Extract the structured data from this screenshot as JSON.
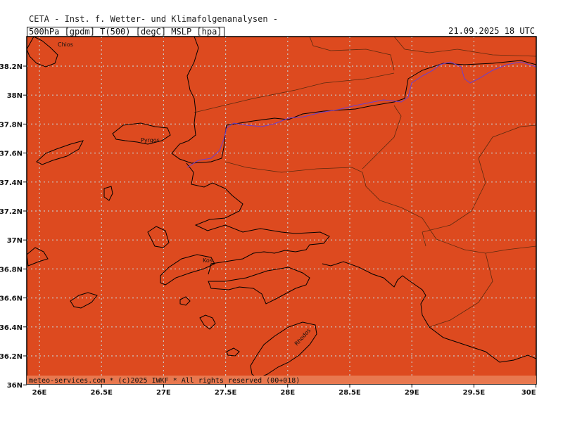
{
  "header": {
    "title": "CETA - Inst. f. Wetter- und Klimafolgenanalysen -",
    "params": "500hPa [gpdm] T(500) [degC] MSLP [hpa]",
    "datetime": "21.09.2025 18 UTC"
  },
  "map": {
    "fill_color": "#dd4a1f",
    "coast_color": "#000000",
    "border_color": "#5a2a10",
    "contour_color": "#6a3fd0",
    "grid_color": "#c8c8c8",
    "lat_labels": [
      "38.2N",
      "38N",
      "37.8N",
      "37.6N",
      "37.4N",
      "37.2N",
      "37N",
      "36.8N",
      "36.6N",
      "36.4N",
      "36.2N",
      "36N"
    ],
    "lon_labels": [
      "26E",
      "26.5E",
      "27E",
      "27.5E",
      "28E",
      "28.5E",
      "29E",
      "29.5E",
      "30E"
    ],
    "places": [
      "Chios",
      "Pyrgos",
      "Kos",
      "Rhodos"
    ]
  },
  "footer": {
    "credit": "meteo-services.com * (c)2025 IWKF * All rights reserved (00+018)"
  }
}
